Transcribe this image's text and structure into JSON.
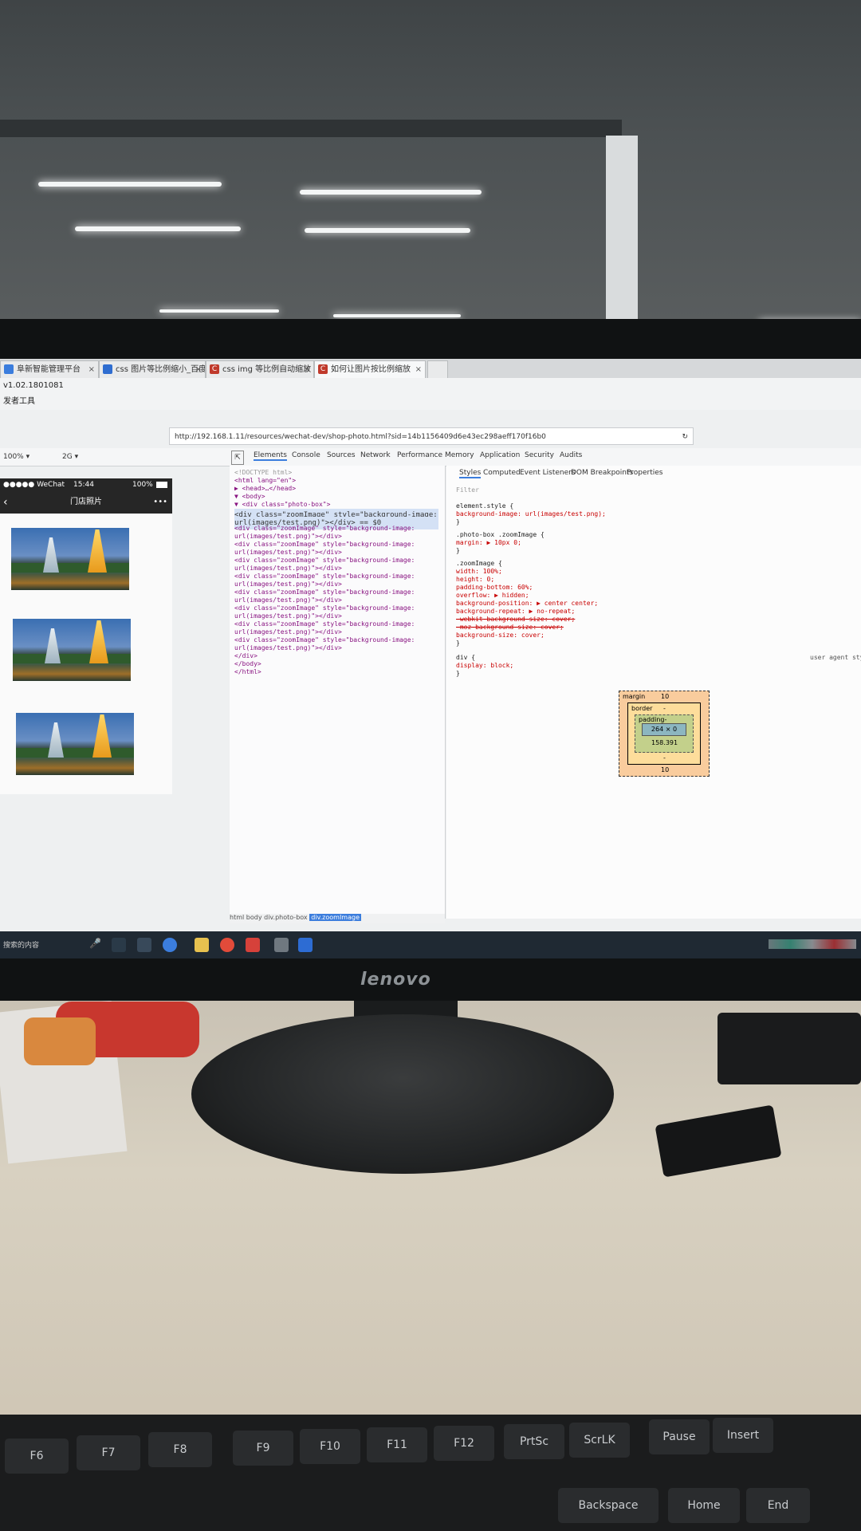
{
  "browser": {
    "tabs": [
      {
        "label": "阜新智能管理平台"
      },
      {
        "label": "css 图片等比例缩小_百度"
      },
      {
        "label": "css img 等比例自动缩放"
      },
      {
        "label": "如何让图片按比例缩放"
      }
    ],
    "version_text": "v1.02.1801081",
    "tools_text": "发者工具",
    "url": "http://192.168.1.11/resources/wechat-dev/shop-photo.html?sid=14b1156409d6e43ec298aeff170f16b0"
  },
  "devtools": {
    "zoom": "100%",
    "network": "2G",
    "tabs": [
      "Elements",
      "Console",
      "Sources",
      "Network",
      "Performance",
      "Memory",
      "Application",
      "Security",
      "Audits"
    ],
    "elements_lines": [
      "<!DOCTYPE html>",
      "<html lang=\"en\">",
      "▶ <head>…</head>",
      "▼ <body>",
      "  ▼ <div class=\"photo-box\">",
      "      <div class=\"zoomImage\" style=\"background-image:",
      "      url(images/test.png)\"></div> == $0",
      "      <div class=\"zoomImage\" style=\"background-image:",
      "      url(images/test.png)\"></div>",
      "      <div class=\"zoomImage\" style=\"background-image:",
      "      url(images/test.png)\"></div>",
      "      <div class=\"zoomImage\" style=\"background-image:",
      "      url(images/test.png)\"></div>",
      "      <div class=\"zoomImage\" style=\"background-image:",
      "      url(images/test.png)\"></div>",
      "      <div class=\"zoomImage\" style=\"background-image:",
      "      url(images/test.png)\"></div>",
      "      <div class=\"zoomImage\" style=\"background-image:",
      "      url(images/test.png)\"></div>",
      "      <div class=\"zoomImage\" style=\"background-image:",
      "      url(images/test.png)\"></div>",
      "      <div class=\"zoomImage\" style=\"background-image:",
      "      url(images/test.png)\"></div>",
      "    </div>",
      "  </body>",
      "</html>"
    ],
    "breadcrumbs": [
      "html",
      "body",
      "div.photo-box",
      "div.zoomImage"
    ],
    "styles_tabs": [
      "Styles",
      "Computed",
      "Event Listeners",
      "DOM Breakpoints",
      "Properties"
    ],
    "filter_label": "Filter",
    "styles_lines": [
      "element.style {",
      "  background-image: url(images/test.png);",
      "}",
      ".photo-box .zoomImage {",
      "  margin: ▶ 10px 0;",
      "}",
      ".zoomImage {",
      "  width: 100%;",
      "  height: 0;",
      "  padding-bottom: 60%;",
      "  overflow: ▶ hidden;",
      "  background-position: ▶ center center;",
      "  background-repeat: ▶ no-repeat;",
      "  -webkit-background-size: cover;",
      "  -moz-background-size: cover;",
      "  background-size: cover;",
      "}",
      "div {",
      "  display: block;",
      "}"
    ],
    "user_agent_label": "user agent sty",
    "box_model": {
      "margin_label": "margin",
      "margin_top": "10",
      "margin_bottom": "10",
      "border_label": "border",
      "border_value": "-",
      "padding_label": "padding-",
      "content": "264 × 0",
      "padding_bottom": "158.391",
      "padding_under": "-"
    }
  },
  "phone": {
    "carrier": "●●●●● WeChat",
    "time": "15:44",
    "battery": "100%",
    "title": "门店照片",
    "more": "•••"
  },
  "taskbar": {
    "search_text": "搜索的内容"
  },
  "monitor": {
    "brand": "lenovo"
  },
  "keyboard": {
    "keys": [
      "F6",
      "F7",
      "F8",
      "F9",
      "F10",
      "F11",
      "F12",
      "PrtSc",
      "ScrLK",
      "Pause",
      "Insert",
      "Backspace",
      "Home",
      "End"
    ]
  }
}
